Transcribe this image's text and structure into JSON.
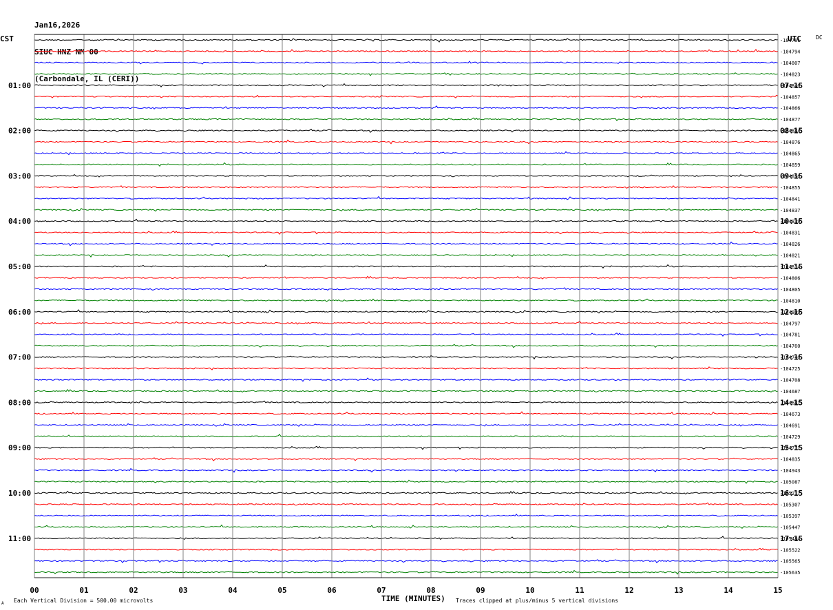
{
  "header": {
    "date": "Jan16,2026",
    "station": "SIUC HNZ NM 00",
    "location": "(Carbondale, IL (CERI))",
    "left_tz": "CST",
    "right_tz": "UTC",
    "dc_label": "DC"
  },
  "footer": {
    "scale_note": "Each Vertical Division =  500.00 microvolts",
    "xlabel": "TIME (MINUTES)",
    "clip_note": "Traces clipped at plus/minus 5 vertical divisions",
    "corner_mark": "A"
  },
  "chart_data": {
    "type": "line",
    "title": "SIUC HNZ NM 00",
    "xlabel": "TIME (MINUTES)",
    "xlim": [
      0,
      15
    ],
    "x_ticks": [
      "00",
      "01",
      "02",
      "03",
      "04",
      "05",
      "06",
      "07",
      "08",
      "09",
      "10",
      "11",
      "12",
      "13",
      "14",
      "15"
    ],
    "trace_colors": [
      "#000000",
      "#ff0000",
      "#0000ff",
      "#008000"
    ],
    "left_hour_labels": [
      "01:00",
      "02:00",
      "03:00",
      "04:00",
      "05:00",
      "06:00",
      "07:00",
      "08:00",
      "09:00",
      "10:00",
      "11:00"
    ],
    "right_hour_labels": [
      "07:15",
      "08:15",
      "09:15",
      "10:15",
      "11:15",
      "12:15",
      "13:15",
      "14:15",
      "15:15",
      "16:15",
      "17:15"
    ],
    "dc_offsets": [
      "-104781",
      "-104794",
      "-104807",
      "-104823",
      "-104840",
      "-104857",
      "-104866",
      "-104877",
      "-104884",
      "-104876",
      "-104865",
      "-104859",
      "-104856",
      "-104855",
      "-104841",
      "-104837",
      "-104839",
      "-104831",
      "-104826",
      "-104821",
      "-104814",
      "-104806",
      "-104805",
      "-104810",
      "-104809",
      "-104797",
      "-104781",
      "-104760",
      "-104740",
      "-104725",
      "-104708",
      "-104687",
      "-104681",
      "-104673",
      "-104691",
      "-104729",
      "-104771",
      "-104835",
      "-104943",
      "-105087",
      "-105217",
      "-105307",
      "-105397",
      "-105447",
      "-105484",
      "-105522",
      "-105565",
      "-105635"
    ]
  }
}
